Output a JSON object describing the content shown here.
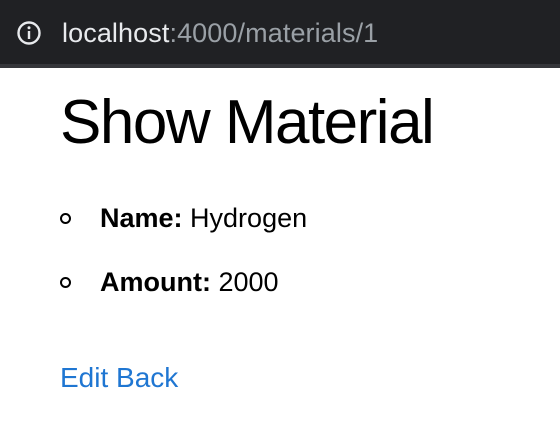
{
  "browser": {
    "url_host": "localhost",
    "url_rest": ":4000/materials/1"
  },
  "page": {
    "title": "Show Material",
    "fields": [
      {
        "label": "Name:",
        "value": "Hydrogen"
      },
      {
        "label": "Amount:",
        "value": "2000"
      }
    ],
    "links": {
      "edit": "Edit",
      "back": "Back"
    }
  },
  "colors": {
    "link": "#1f76d2",
    "address_bar": "#202124"
  },
  "icons": {
    "address_bar": "info-icon"
  }
}
